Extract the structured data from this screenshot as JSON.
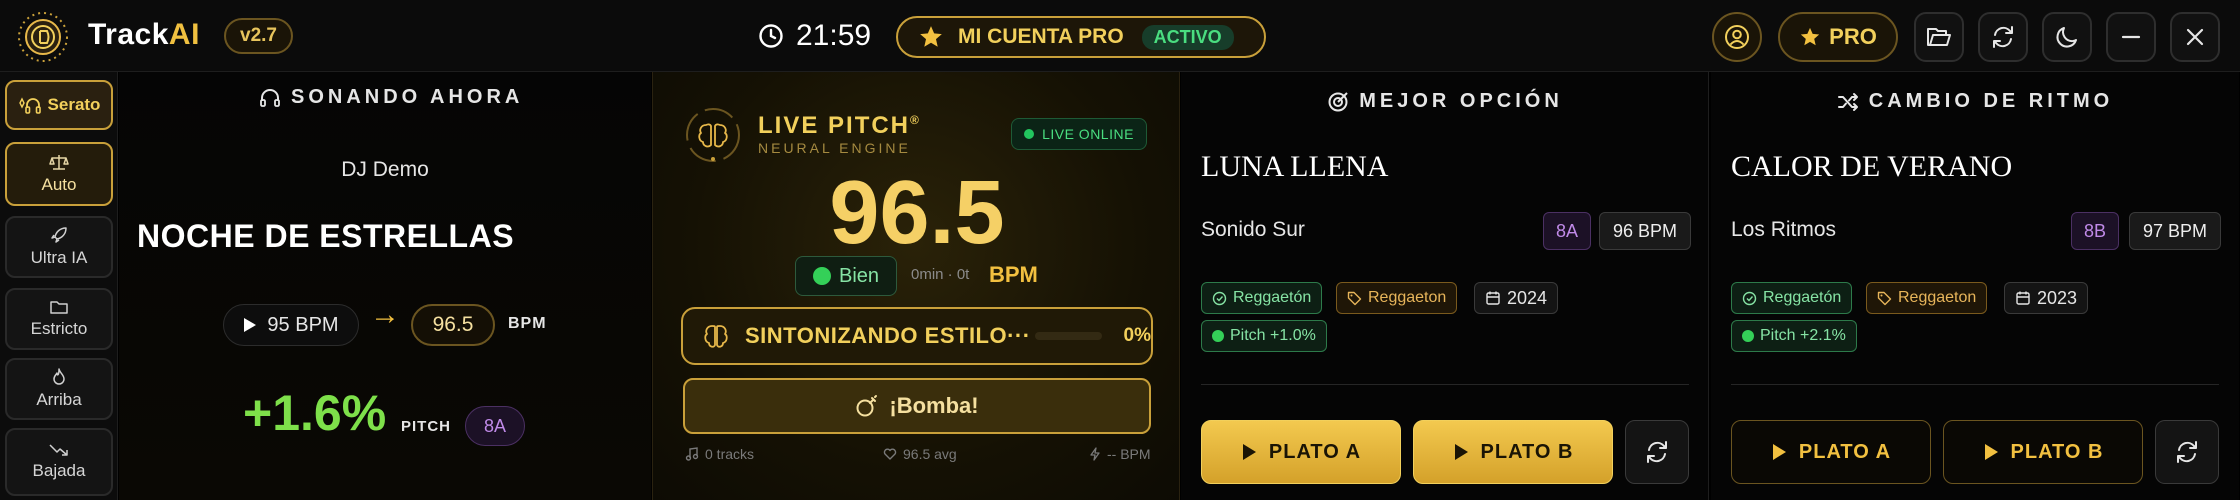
{
  "header": {
    "brand_track": "Track",
    "brand_ai": "AI",
    "version": "v2.7",
    "time": "21:59",
    "pro_account_label": "MI CUENTA PRO",
    "pro_account_status": "ACTIVO",
    "pro_button_label": "PRO"
  },
  "sidebar": {
    "items": [
      {
        "label": "Serato",
        "icon": "headset-sparkle-icon"
      },
      {
        "label": "Auto",
        "icon": "scale-icon"
      },
      {
        "label": "Ultra IA",
        "icon": "rocket-icon"
      },
      {
        "label": "Estricto",
        "icon": "folder-icon"
      },
      {
        "label": "Arriba",
        "icon": "flame-icon"
      },
      {
        "label": "Bajada",
        "icon": "trend-down-icon"
      }
    ]
  },
  "now_playing": {
    "title": "SONANDO AHORA",
    "artist": "DJ Demo",
    "song": "NOCHE DE ESTRELLAS",
    "bpm_from": "95 BPM",
    "bpm_to": "96.5",
    "bpm_unit": "BPM",
    "pitch": "+1.6%",
    "pitch_label": "PITCH",
    "key": "8A"
  },
  "live_pitch": {
    "title": "LIVE PITCH",
    "registered": "®",
    "subtitle": "NEURAL ENGINE",
    "status": "LIVE ONLINE",
    "bpm": "96.5",
    "quality": "Bien",
    "elapsed": "0min · 0t",
    "bpm_label": "BPM",
    "tuning_label": "SINTONIZANDO ESTILO···",
    "tuning_percent": "0%",
    "tuning_progress": 0,
    "bomb_label": "¡Bomba!",
    "footer_tracks": "0 tracks",
    "footer_avg": "96.5 avg",
    "footer_bpm": "-- BPM"
  },
  "best_option": {
    "title": "MEJOR OPCIÓN",
    "song": "LUNA LLENA",
    "artist": "Sonido Sur",
    "key": "8A",
    "bpm": "96 BPM",
    "tag_genre_match": "Reggaetón",
    "tag_genre": "Reggaeton",
    "year": "2024",
    "pitch": "Pitch +1.0%",
    "plate_a": "PLATO A",
    "plate_b": "PLATO B"
  },
  "rhythm_change": {
    "title": "CAMBIO DE RITMO",
    "song": "CALOR DE VERANO",
    "artist": "Los Ritmos",
    "key": "8B",
    "bpm": "97 BPM",
    "tag_genre_match": "Reggaetón",
    "tag_genre": "Reggaeton",
    "year": "2023",
    "pitch": "Pitch +2.1%",
    "plate_a": "PLATO A",
    "plate_b": "PLATO B"
  },
  "colors": {
    "accent_gold": "#f2c040",
    "pitch_green": "#7ee04a",
    "status_green": "#4ade80",
    "key_purple": "#c08ae8"
  }
}
